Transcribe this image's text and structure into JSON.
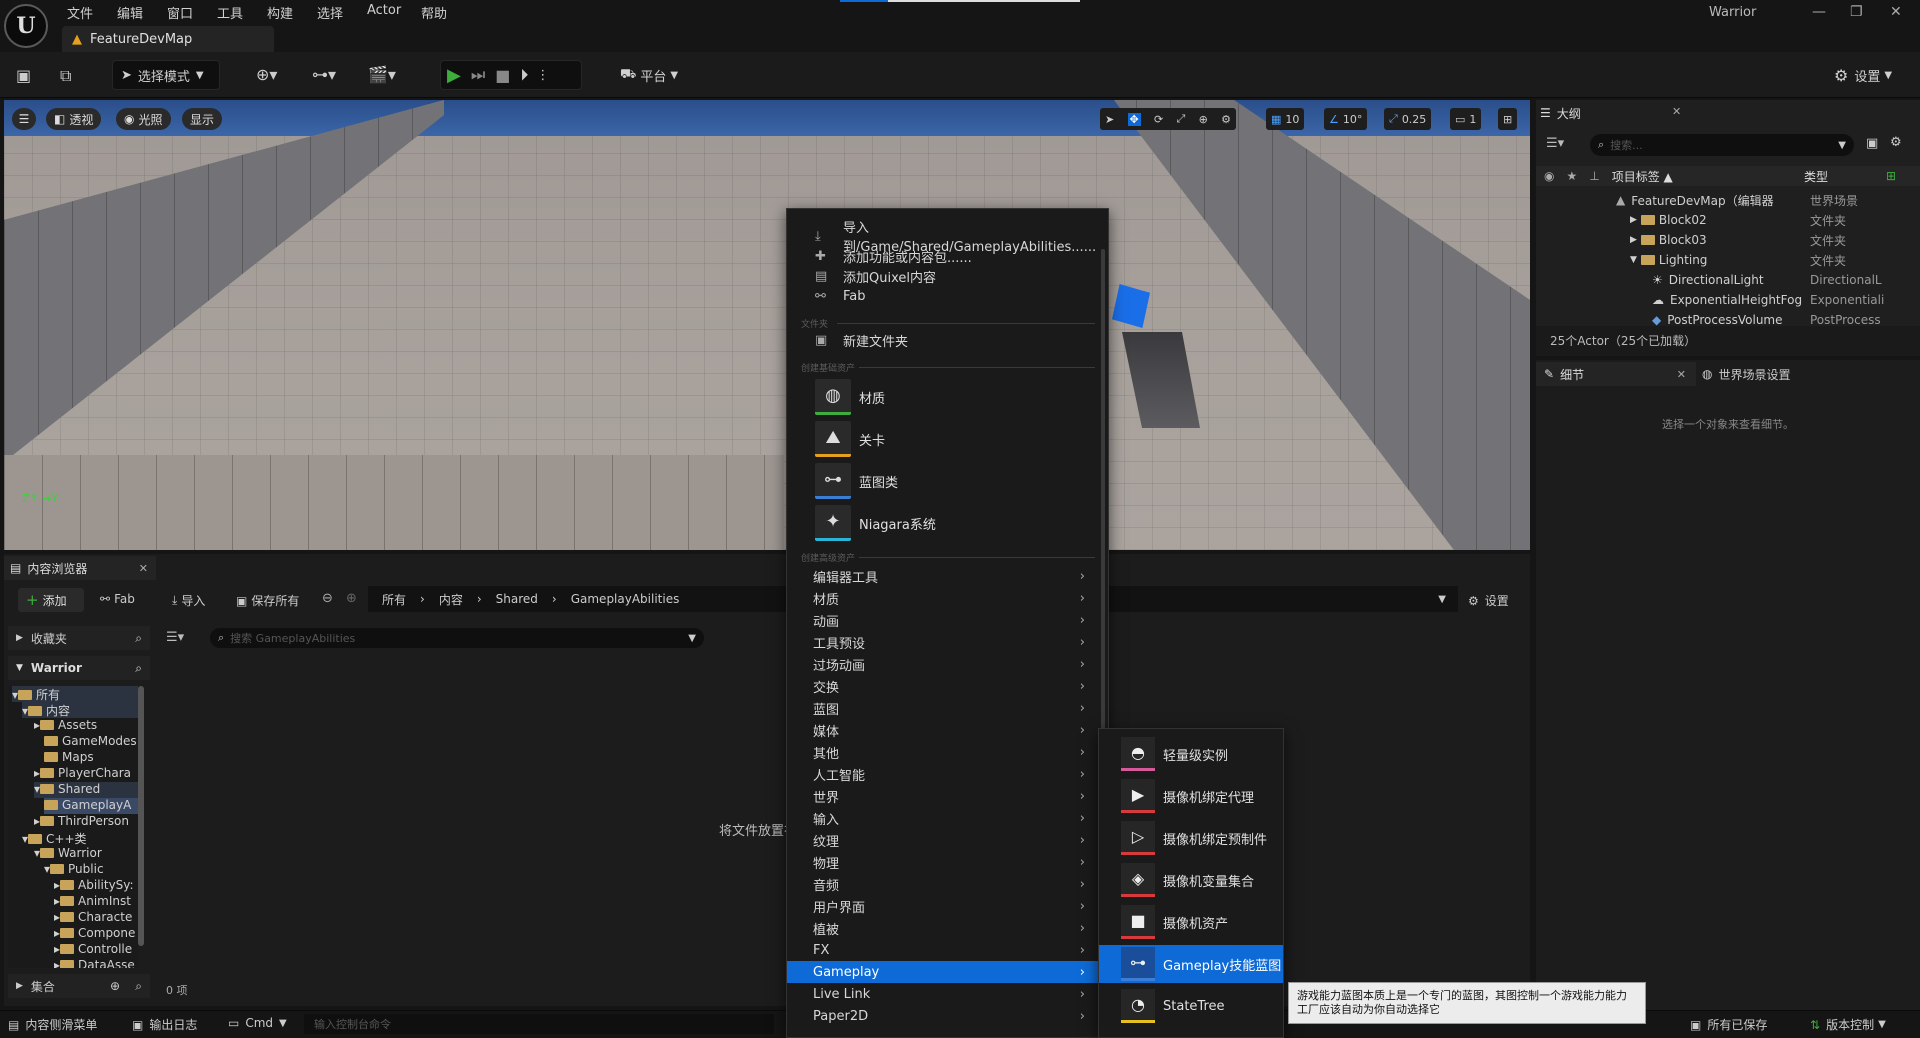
{
  "menubar": {
    "items": [
      "文件",
      "编辑",
      "窗口",
      "工具",
      "构建",
      "选择",
      "Actor",
      "帮助"
    ],
    "project": "Warrior"
  },
  "tab": {
    "title": "FeatureDevMap"
  },
  "toolbar": {
    "mode": "选择模式",
    "platform": "平台",
    "settings": "设置"
  },
  "viewport": {
    "perspective": "透视",
    "lit": "光照",
    "show": "显示",
    "grid": "10",
    "angle": "10°",
    "scale": "0.25",
    "camera": "1"
  },
  "outliner": {
    "title": "大纲",
    "search_placeholder": "搜索...",
    "col_label": "项目标签 ▲",
    "col_type": "类型",
    "rows": [
      {
        "name": "FeatureDevMap（编辑器",
        "type": "世界场景"
      },
      {
        "name": "Block02",
        "type": "文件夹"
      },
      {
        "name": "Block03",
        "type": "文件夹"
      },
      {
        "name": "Lighting",
        "type": "文件夹"
      },
      {
        "name": "DirectionalLight",
        "type": "DirectionalL"
      },
      {
        "name": "ExponentialHeightFog",
        "type": "Exponentiali"
      },
      {
        "name": "PostProcessVolume",
        "type": "PostProcess"
      }
    ],
    "status": "25个Actor（25个已加载）"
  },
  "details": {
    "tab": "细节",
    "world_tab": "世界场景设置",
    "empty": "选择一个对象来查看细节。"
  },
  "content_browser": {
    "title": "内容浏览器",
    "add": "添加",
    "fab": "Fab",
    "import": "导入",
    "save_all": "保存所有",
    "breadcrumb": [
      "所有",
      "内容",
      "Shared",
      "GameplayAbilities"
    ],
    "settings": "设置",
    "favorites": "收藏夹",
    "project": "Warrior",
    "search_placeholder": "搜索 GameplayAbilities",
    "drop_hint": "将文件放置在",
    "tree": [
      "所有",
      "内容",
      "Assets",
      "GameModes",
      "Maps",
      "PlayerChara",
      "Shared",
      "GameplayA",
      "ThirdPerson",
      "C++类",
      "Warrior",
      "Public",
      "AbilitySy:",
      "AnimInst",
      "Characte",
      "Compone",
      "Controlle",
      "DataAsse"
    ],
    "collections": "集合",
    "count": "0 项"
  },
  "context_menu": {
    "top": [
      "导入到/Game/Shared/GameplayAbilities......",
      "添加功能或内容包......",
      "添加Quixel内容",
      "Fab"
    ],
    "sec_folder": "文件夹",
    "new_folder": "新建文件夹",
    "sec_basic": "创建基础资产",
    "basic": [
      "材质",
      "关卡",
      "蓝图类",
      "Niagara系统"
    ],
    "sec_adv": "创建高级资产",
    "adv": [
      "编辑器工具",
      "材质",
      "动画",
      "工具预设",
      "过场动画",
      "交换",
      "蓝图",
      "媒体",
      "其他",
      "人工智能",
      "世界",
      "输入",
      "纹理",
      "物理",
      "音频",
      "用户界面",
      "植被",
      "FX",
      "Gameplay",
      "Live Link",
      "Paper2D"
    ]
  },
  "submenu": {
    "items": [
      "轻量级实例",
      "摄像机绑定代理",
      "摄像机绑定预制件",
      "摄像机变量集合",
      "摄像机资产",
      "Gameplay技能蓝图",
      "StateTree"
    ]
  },
  "tooltip": {
    "text": "游戏能力蓝图本质上是一个专门的蓝图，其图控制一个游戏能力能力工厂应该自动为你自动选择它"
  },
  "statusbar": {
    "drawer": "内容侧滑菜单",
    "log": "输出日志",
    "cmd": "Cmd",
    "cmd_placeholder": "输入控制台命令",
    "saved": "所有已保存",
    "vcs": "版本控制"
  },
  "colors": {
    "accent": "#0e6ad6",
    "play": "#3dae3d"
  }
}
